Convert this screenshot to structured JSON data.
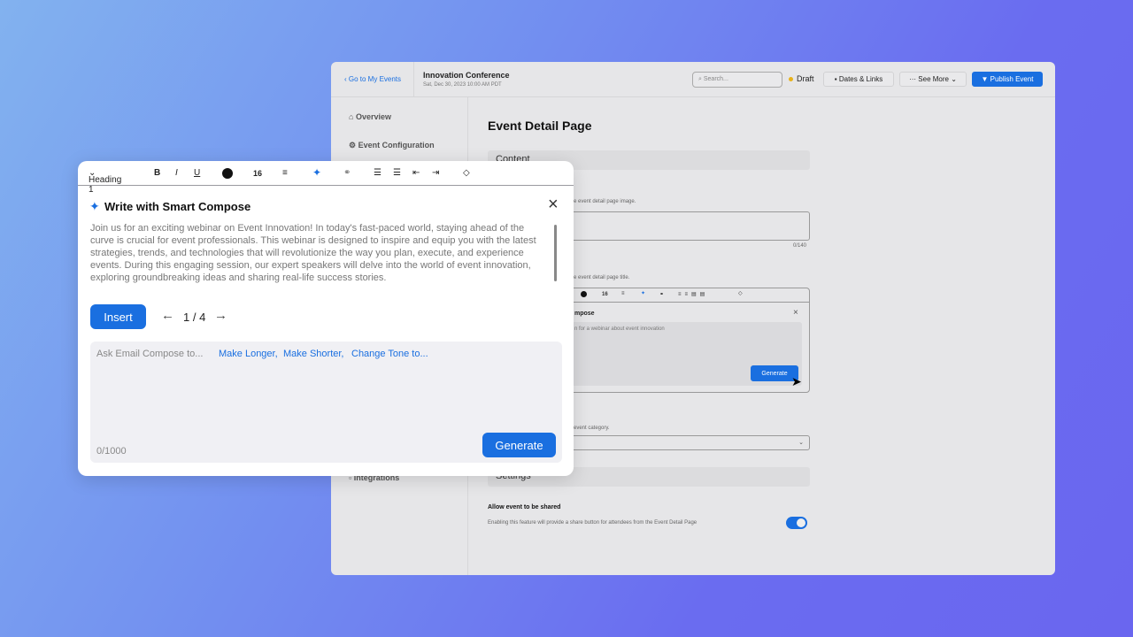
{
  "header": {
    "back": "Go to My Events",
    "event_title": "Innovation Conference",
    "event_date": "Sat, Dec 30, 2023 10:00 AM PDT",
    "search_placeholder": "Search...",
    "status": "Draft",
    "dates_links": "Dates & Links",
    "see_more": "See More",
    "publish": "Publish Event"
  },
  "sidebar": {
    "items": [
      {
        "label": "Overview"
      },
      {
        "label": "Event Configuration"
      },
      {
        "label": "Integrations"
      }
    ]
  },
  "main": {
    "title": "Event Detail Page",
    "content_section": "Content",
    "image_hint": "e event detail page image.",
    "image_count": "0/140",
    "title_hint": "e event detail page title.",
    "mini_font_size": "16",
    "mini_compose_title": "mpose",
    "mini_prompt": "n for a webinar about event innovation",
    "mini_generate": "Generate",
    "category_hint": "event category.",
    "settings_section": "Settings",
    "share_label": "Allow event to be shared",
    "share_desc": "Enabling this feature will provide a share button for attendees from the Event Detail Page",
    "share_enabled": true
  },
  "popup": {
    "heading_select": "Heading 1",
    "font_size": "16",
    "title": "Write with Smart Compose",
    "body": "Join us for an exciting webinar on Event Innovation! In today's fast-paced world, staying ahead of the curve is crucial for event professionals. This webinar is designed to inspire and equip you with the latest strategies, trends, and technologies that will revolutionize the way you plan, execute, and experience events. During this engaging session, our expert speakers will delve into the world of event innovation, exploring groundbreaking ideas and sharing real-life success stories.",
    "insert": "Insert",
    "pager": "1 / 4",
    "prompt_placeholder": "Ask Email Compose to...",
    "suggestions": [
      "Make Longer,",
      "Make Shorter,",
      "Change Tone to..."
    ],
    "count": "0/1000",
    "generate": "Generate"
  },
  "colors": {
    "accent": "#1a6fe0",
    "draft_dot": "#e8b21a"
  }
}
